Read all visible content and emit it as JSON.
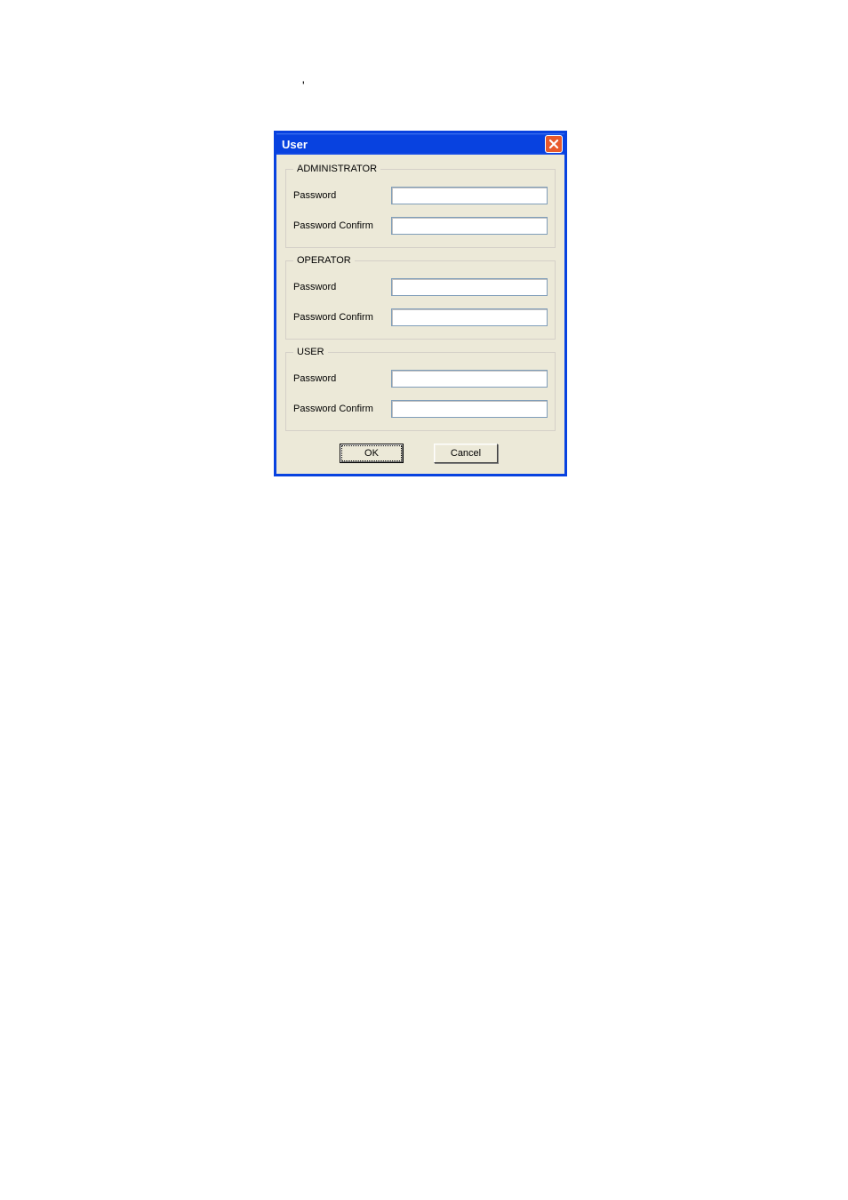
{
  "stray_text": "'",
  "dialog": {
    "title": "User",
    "groups": [
      {
        "legend": "ADMINISTRATOR",
        "password_label": "Password",
        "password_value": "",
        "confirm_label": "Password Confirm",
        "confirm_value": ""
      },
      {
        "legend": "OPERATOR",
        "password_label": "Password",
        "password_value": "",
        "confirm_label": "Password Confirm",
        "confirm_value": ""
      },
      {
        "legend": "USER",
        "password_label": "Password",
        "password_value": "",
        "confirm_label": "Password Confirm",
        "confirm_value": ""
      }
    ],
    "buttons": {
      "ok": "OK",
      "cancel": "Cancel"
    }
  }
}
